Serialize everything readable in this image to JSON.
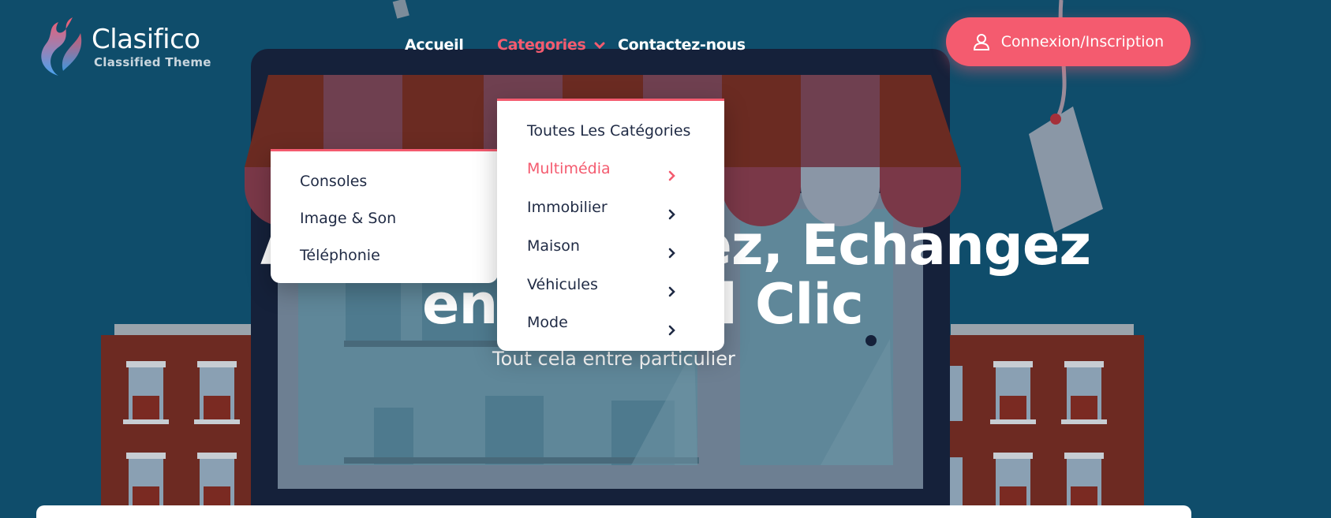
{
  "brand": {
    "name": "Clasifico",
    "tagline": "Classified Theme"
  },
  "nav": {
    "home": "Accueil",
    "categories": "Categories",
    "contact": "Contactez-nous"
  },
  "login": {
    "label": "Connexion/Inscription",
    "icon": "user-icon"
  },
  "hero": {
    "line1": "Achetez, Vendez, Echangez",
    "line2": "en un seul Clic",
    "subtitle": "Tout cela entre particulier"
  },
  "categories_menu": {
    "items": [
      {
        "label": "Toutes Les Catégories",
        "has_sub": false
      },
      {
        "label": "Multimédia",
        "has_sub": true,
        "active": true
      },
      {
        "label": "Immobilier",
        "has_sub": true
      },
      {
        "label": "Maison",
        "has_sub": true
      },
      {
        "label": "Véhicules",
        "has_sub": true
      },
      {
        "label": "Mode",
        "has_sub": true
      }
    ]
  },
  "submenu": {
    "items": [
      "Consoles",
      "Image & Son",
      "Téléphonie"
    ]
  },
  "colors": {
    "accent": "#f45b6f",
    "background": "#0f4d6b",
    "menu_text": "#1f2a44"
  }
}
